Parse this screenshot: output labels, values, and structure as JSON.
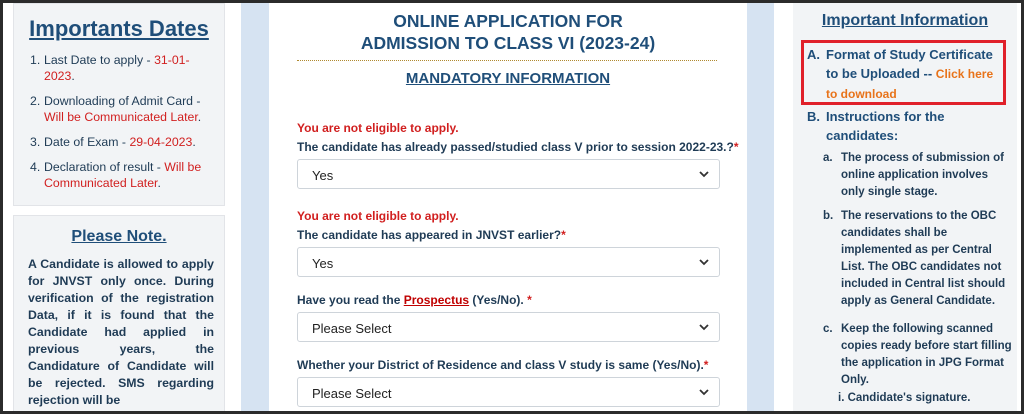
{
  "important_dates": {
    "title": "Importants Dates",
    "items": [
      {
        "num": "1.",
        "text": "Last Date to apply - ",
        "highlight": "31-01-2023",
        "suffix": "."
      },
      {
        "num": "2.",
        "text": "Downloading of Admit Card - ",
        "highlight": "Will be Communicated Later",
        "suffix": "."
      },
      {
        "num": "3.",
        "text": "Date of Exam - ",
        "highlight": "29-04-2023",
        "suffix": "."
      },
      {
        "num": "4.",
        "text": "Declaration of result - ",
        "highlight": "Will be Communicated Later",
        "suffix": "."
      }
    ]
  },
  "please_note": {
    "title": "Please Note.",
    "text": "A Candidate is allowed to apply for JNVST only once. During verification of the registration Data, if it is found that the Candidate had applied in previous years, the Candidature of Candidate will be rejected. SMS regarding rejection will be"
  },
  "form": {
    "title_line1": "ONLINE APPLICATION FOR",
    "title_line2": "ADMISSION TO CLASS VI (2023-24)",
    "section": "MANDATORY INFORMATION",
    "q1": {
      "error": "You are not eligible to apply.",
      "label": "The candidate has already passed/studied class V prior to session 2022-23.?",
      "star": "*",
      "value": "Yes"
    },
    "q2": {
      "error": "You are not eligible to apply.",
      "label": "The candidate has appeared in JNVST earlier?",
      "star": "*",
      "value": "Yes"
    },
    "q3": {
      "label_pre": "Have you read the ",
      "link": "Prospectus",
      "label_post": " (Yes/No). ",
      "star": "*",
      "value": "Please Select"
    },
    "q4": {
      "label": "Whether your District of Residence and class V study is same (Yes/No).",
      "star": "*",
      "value": "Please Select"
    }
  },
  "info": {
    "title": "Important Information",
    "a_label": "A.",
    "a_text": "Format of Study Certificate to be Uploaded -- ",
    "a_link": "Click here to download",
    "b_label": "B.",
    "b_text": "Instructions for the candidates:",
    "items": [
      {
        "label": "a.",
        "text": "The process of submission of online application involves only single stage."
      },
      {
        "label": "b.",
        "text": "The reservations to the OBC candidates shall be implemented as per Central List. The OBC candidates not included in Central list should apply as General Candidate."
      },
      {
        "label": "c.",
        "text": "Keep the following scanned copies ready before start filling the application in JPG Format Only."
      }
    ],
    "sub_item": "i. Candidate's signature."
  },
  "colors": {
    "accent": "#1f4e79",
    "error": "#d11f1f",
    "highlight_border": "#e0202a",
    "download_link": "#e8731a"
  }
}
